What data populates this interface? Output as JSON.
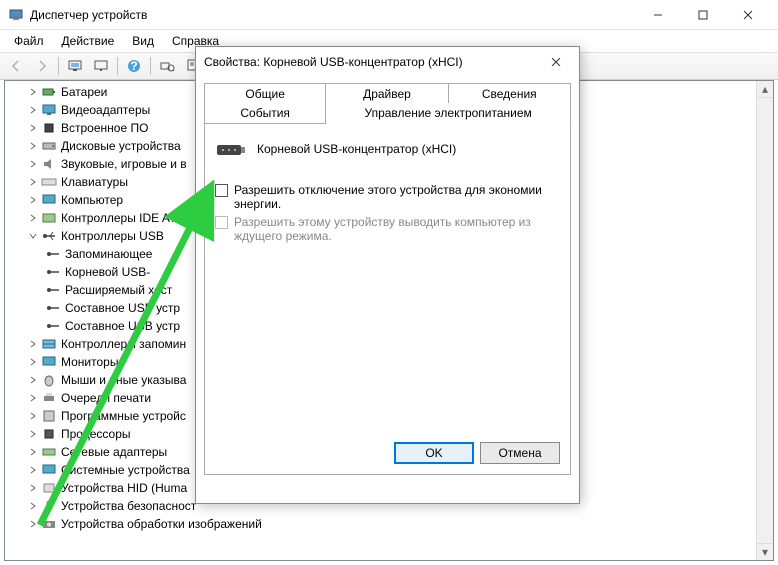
{
  "window": {
    "title": "Диспетчер устройств"
  },
  "menu": {
    "file": "Файл",
    "action": "Действие",
    "view": "Вид",
    "help": "Справка"
  },
  "tree": {
    "n0": "Батареи",
    "n1": "Видеоадаптеры",
    "n2": "Встроенное ПО",
    "n3": "Дисковые устройства",
    "n4": "Звуковые, игровые и в",
    "n5": "Клавиатуры",
    "n6": "Компьютер",
    "n7": "Контроллеры IDE ATA/",
    "n8": "Контроллеры USB",
    "n8_0": "Запоминающее",
    "n8_1": "Корневой USB-",
    "n8_2": "Расширяемый хост",
    "n8_3": "Составное USB устр",
    "n8_4": "Составное USB устр",
    "n9": "Контроллеры запомин",
    "n10": "Мониторы",
    "n11": "Мыши и иные указыва",
    "n12": "Очереди печати",
    "n13": "Программные устройс",
    "n14": "Процессоры",
    "n15": "Сетевые адаптеры",
    "n16": "Системные устройства",
    "n17": "Устройства HID (Huma",
    "n18": "Устройства безопасност",
    "n19": "Устройства обработки изображений"
  },
  "dialog": {
    "title": "Свойства: Корневой USB-концентратор (xHCI)",
    "tabs": {
      "general": "Общие",
      "driver": "Драйвер",
      "details": "Сведения",
      "events": "События",
      "power": "Управление электропитанием"
    },
    "device_name": "Корневой USB-концентратор (xHCI)",
    "chk1": "Разрешить отключение этого устройства для экономии энергии.",
    "chk2": "Разрешить этому устройству выводить компьютер из ждущего режима.",
    "ok": "OK",
    "cancel": "Отмена"
  }
}
